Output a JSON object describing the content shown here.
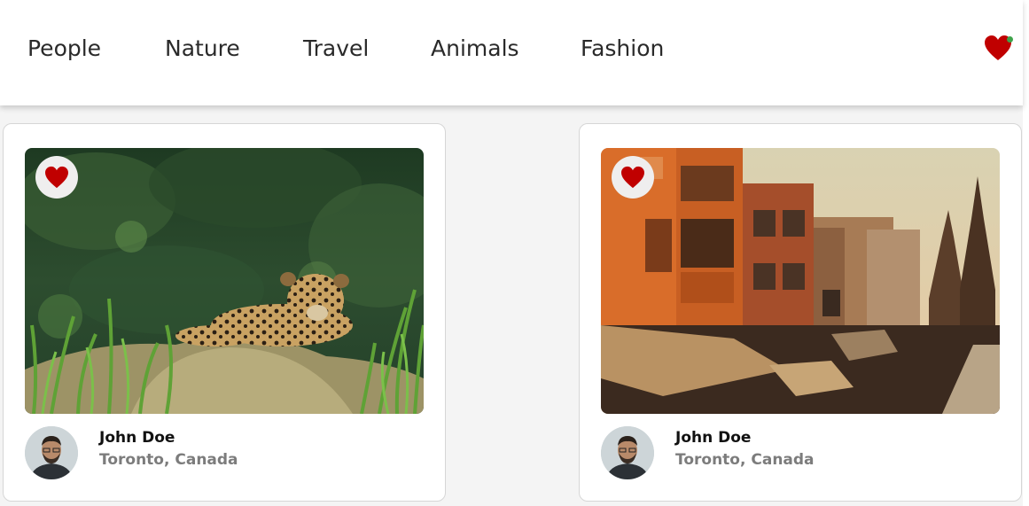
{
  "nav": {
    "items": [
      "People",
      "Nature",
      "Travel",
      "Animals",
      "Fashion"
    ],
    "favorites_icon": "heart-icon"
  },
  "colors": {
    "heart": "#c00000",
    "notification_dot": "#3ea34a",
    "secondary_text": "#7c7c7c"
  },
  "cards": [
    {
      "image": "jaguar lying in tall grass",
      "favorite_icon": "heart-icon",
      "author": {
        "name": "John Doe",
        "location": "Toronto, Canada"
      }
    },
    {
      "image": "old town street with colorful buildings and temple spires",
      "favorite_icon": "heart-icon",
      "author": {
        "name": "John Doe",
        "location": "Toronto, Canada"
      }
    }
  ]
}
